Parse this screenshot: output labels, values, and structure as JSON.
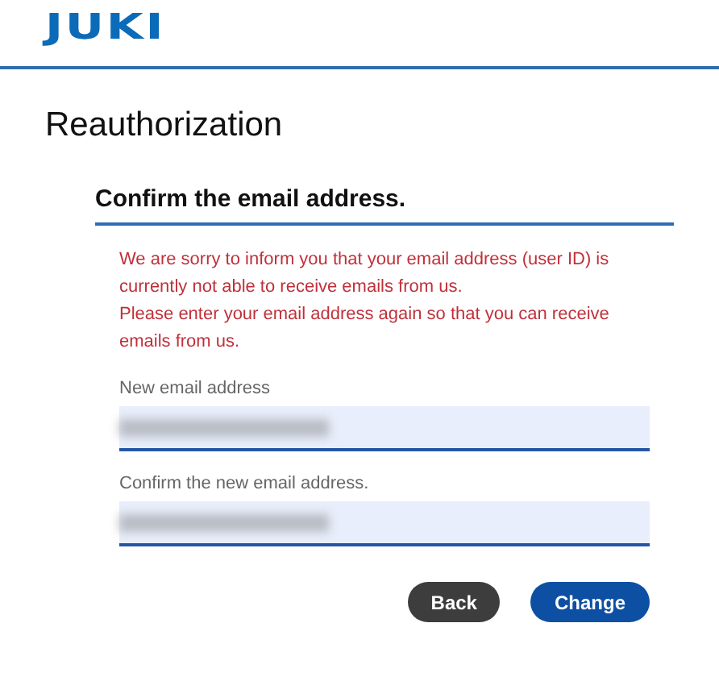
{
  "logo": "JUKI",
  "title": "Reauthorization",
  "section": {
    "heading": "Confirm the email address.",
    "message": [
      "We are sorry to inform you that your email address (user ID) is currently not able to receive emails from us.",
      "Please enter your email address again so that you can receive emails from us."
    ],
    "fields": [
      {
        "label": "New email address"
      },
      {
        "label": "Confirm the new email address."
      }
    ]
  },
  "buttons": [
    {
      "label": "Back",
      "kind": "secondary"
    },
    {
      "label": "Change",
      "kind": "primary"
    }
  ]
}
